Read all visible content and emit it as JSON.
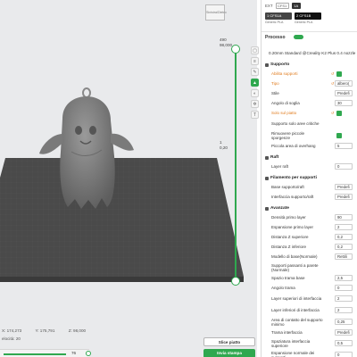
{
  "viewport": {
    "gizmo_label": "Sinistra/Dietro",
    "layer_top": {
      "layer": "490",
      "height": "98,000"
    },
    "layer_bottom": {
      "layer": "1",
      "height": "0,20"
    },
    "coords": {
      "x": "X: 174,273",
      "y": "Y: 175,791",
      "z": "Z: 98,000"
    },
    "speed_text": "elocità: 20",
    "hslider_value": "76",
    "slider_top_fraction": 1.0,
    "slider_bottom_fraction": 0.0
  },
  "actions": {
    "slice": "Slice piatto",
    "print": "Invia stampa"
  },
  "toolbar_icons": [
    "cube-icon",
    "layers-icon",
    "pencil-icon",
    "support-icon",
    "seam-icon",
    "fuzzy-icon",
    "text-icon"
  ],
  "panel": {
    "ext_row": {
      "ext": "EXT",
      "cfs1": "CFS1",
      "cfs1_num": "1A"
    },
    "filaments": [
      {
        "id": "1",
        "code": "CFS1A",
        "name": "Generic PLA",
        "color": "#444444"
      },
      {
        "id": "2",
        "code": "CFS1B",
        "name": "Generic PLA",
        "color": "#111111"
      }
    ],
    "process_label": "Processo",
    "profile_name": "0.20mm Standard @Creality K2 Plus 0.4 nozzle",
    "sections": {
      "supporto": "Supporto",
      "raft": "Raft",
      "filamento_supporti": "Filamento per supporti",
      "avanzate": "Avanzate"
    },
    "support_rows": [
      {
        "label": "Abilita supporti",
        "value": "",
        "orange": true,
        "checkbox": true
      },
      {
        "label": "Tipo",
        "value": "albero(",
        "orange": true,
        "checkbox": false
      },
      {
        "label": "Stile",
        "value": "Predefi",
        "orange": false,
        "checkbox": false
      },
      {
        "label": "Angolo di soglia",
        "value": "30",
        "orange": false,
        "checkbox": false
      },
      {
        "label": "Solo sul piatto",
        "value": "",
        "orange": true,
        "checkbox": true
      },
      {
        "label": "Supporto solo aree critiche",
        "value": "",
        "orange": false,
        "checkbox": false
      },
      {
        "label": "Rimuovere piccole sporgenze",
        "value": "",
        "orange": false,
        "checkbox": true
      },
      {
        "label": "Piccola area di overhang",
        "value": "5",
        "orange": false,
        "checkbox": false
      }
    ],
    "raft_rows": [
      {
        "label": "Layer raft",
        "value": "0"
      }
    ],
    "filament_rows": [
      {
        "label": "Base supporto/raft",
        "value": "Predefi"
      },
      {
        "label": "Interfaccia supporto/raft",
        "value": "Predefi"
      }
    ],
    "advanced_rows": [
      {
        "label": "Densità primo layer",
        "value": "90"
      },
      {
        "label": "Espansione primo layer",
        "value": "2"
      },
      {
        "label": "Distanza Z superiore",
        "value": "0,2"
      },
      {
        "label": "Distanza Z inferiore",
        "value": "0,2"
      },
      {
        "label": "Modello di base(Normale)",
        "value": "Rettili"
      },
      {
        "label": "Supporti passanti a parete (Normale)",
        "value": ""
      },
      {
        "label": "Spazio trama base",
        "value": "2,5"
      },
      {
        "label": "Angolo trama",
        "value": "0"
      },
      {
        "label": "Layer superiori di interfaccia",
        "value": "2"
      },
      {
        "label": "Layer inferiori di interfaccia",
        "value": "2"
      },
      {
        "label": "Area di contatto del supporto minimo",
        "value": "0,25"
      },
      {
        "label": "Trama interfaccia",
        "value": "Predefi"
      },
      {
        "label": "Spaziatura interfaccia superiore",
        "value": "0,5"
      },
      {
        "label": "Espansione normale dei supporti",
        "value": "0"
      },
      {
        "label": "Distanza xy supporto/oggetto",
        "value": "0,35"
      }
    ]
  }
}
